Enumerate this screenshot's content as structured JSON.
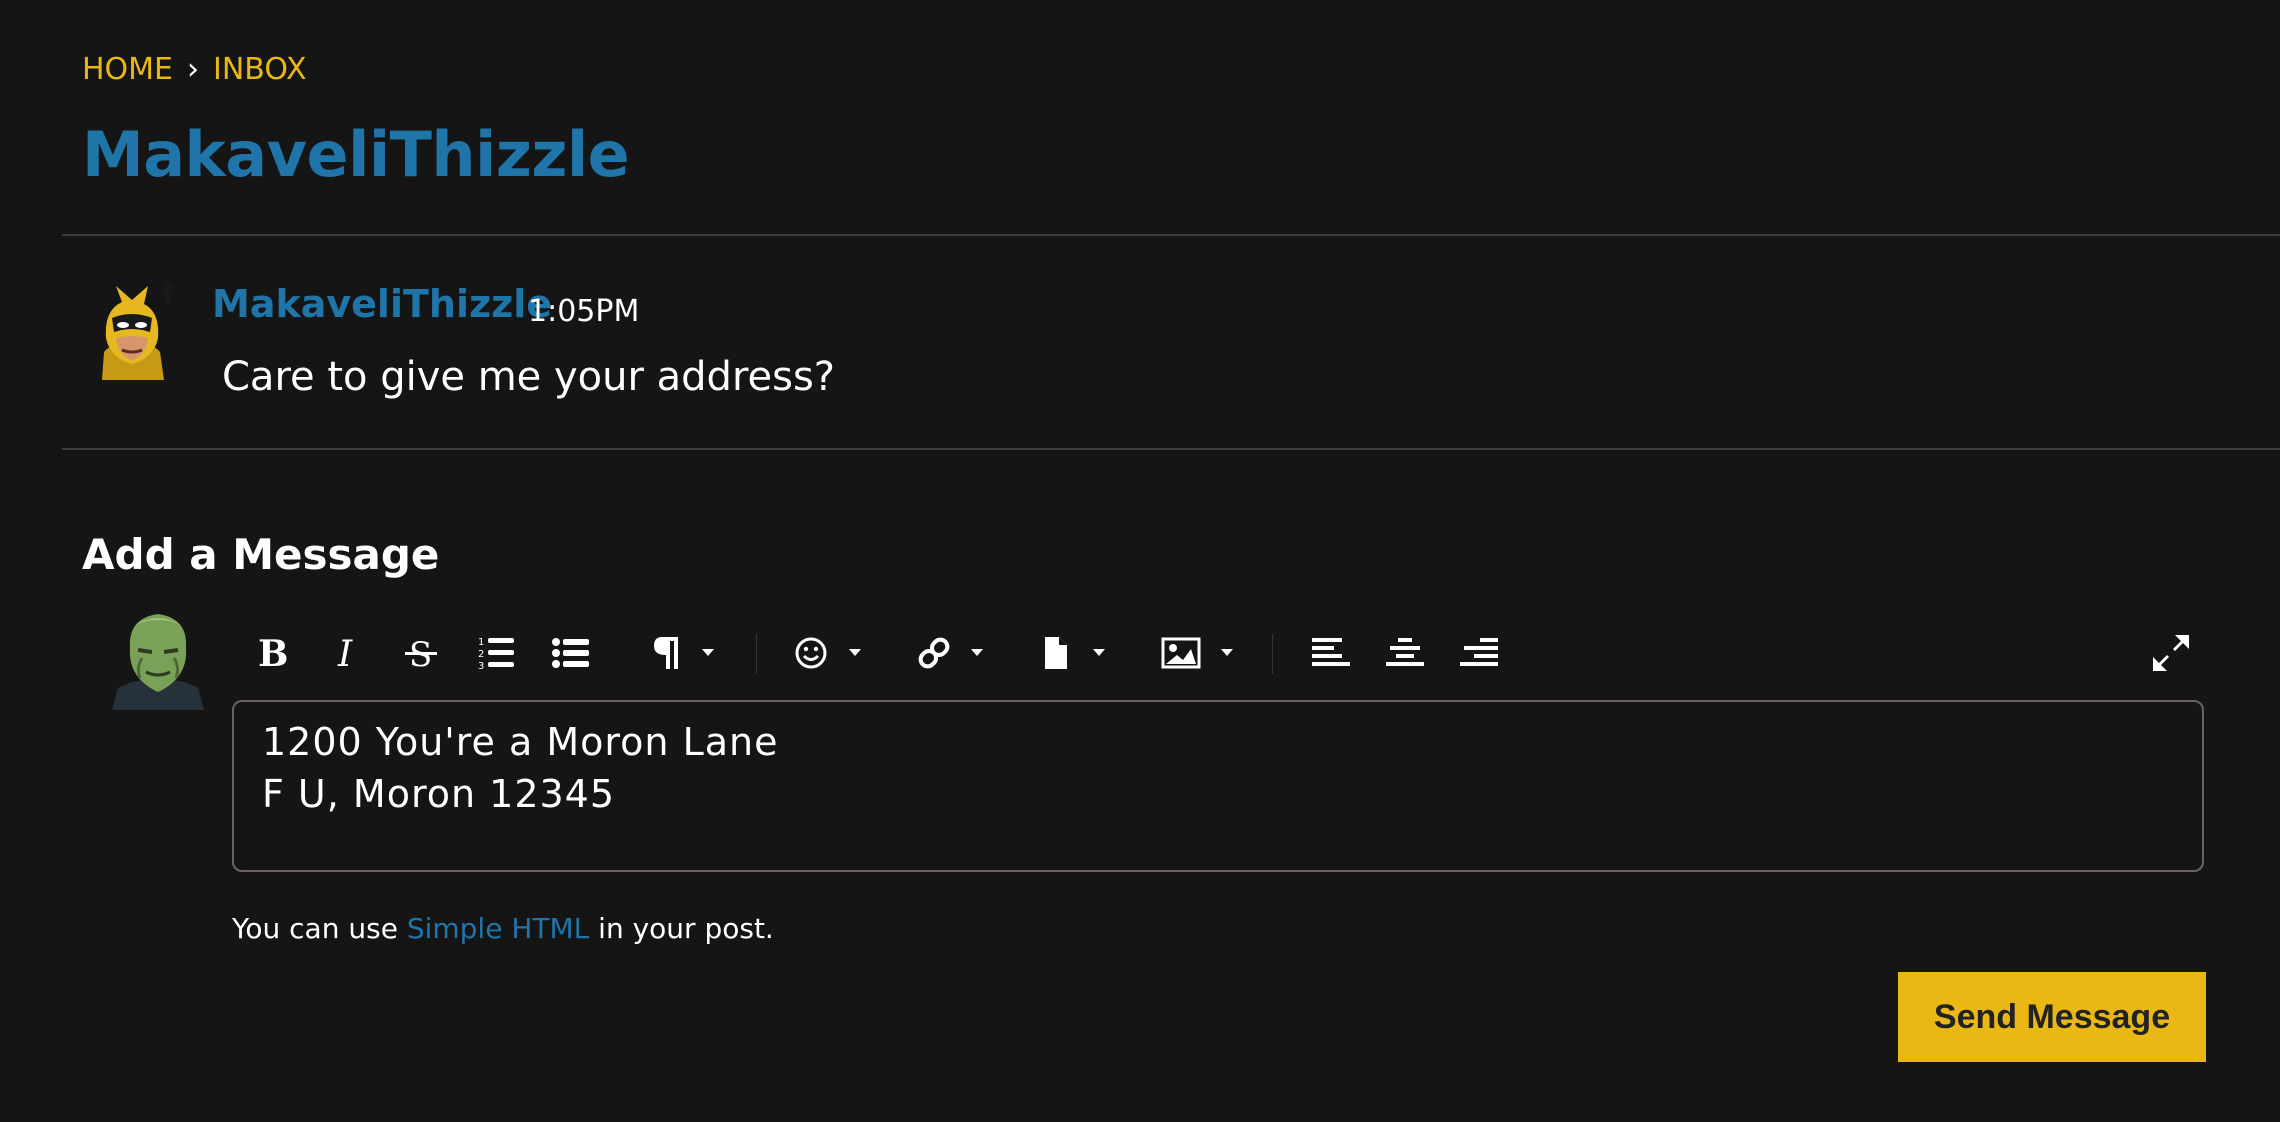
{
  "breadcrumb": {
    "home": "HOME",
    "separator": "›",
    "inbox": "INBOX"
  },
  "page_title": "MakaveliThizzle",
  "message": {
    "author": "MakaveliThizzle",
    "time": "1:05PM",
    "body": "Care to give me your address?",
    "avatar_icon": "wolverine-avatar"
  },
  "compose": {
    "title": "Add a Message",
    "avatar_icon": "skrull-avatar",
    "toolbar": [
      "bold-icon",
      "italic-icon",
      "strikethrough-icon",
      "ordered-list-icon",
      "bullet-list-icon",
      "paragraph-icon",
      "emoji-icon",
      "link-icon",
      "file-icon",
      "image-icon",
      "align-left-icon",
      "align-center-icon",
      "align-right-icon",
      "fullscreen-icon"
    ],
    "editor_lines": [
      "1200 You're a Moron Lane",
      "F U, Moron 12345"
    ],
    "hint_prefix": "You can use ",
    "hint_link": "Simple HTML",
    "hint_suffix": " in your post.",
    "send_label": "Send Message"
  },
  "colors": {
    "background": "#151515",
    "accent_yellow": "#e9b815",
    "link_blue": "#1f74a8"
  }
}
